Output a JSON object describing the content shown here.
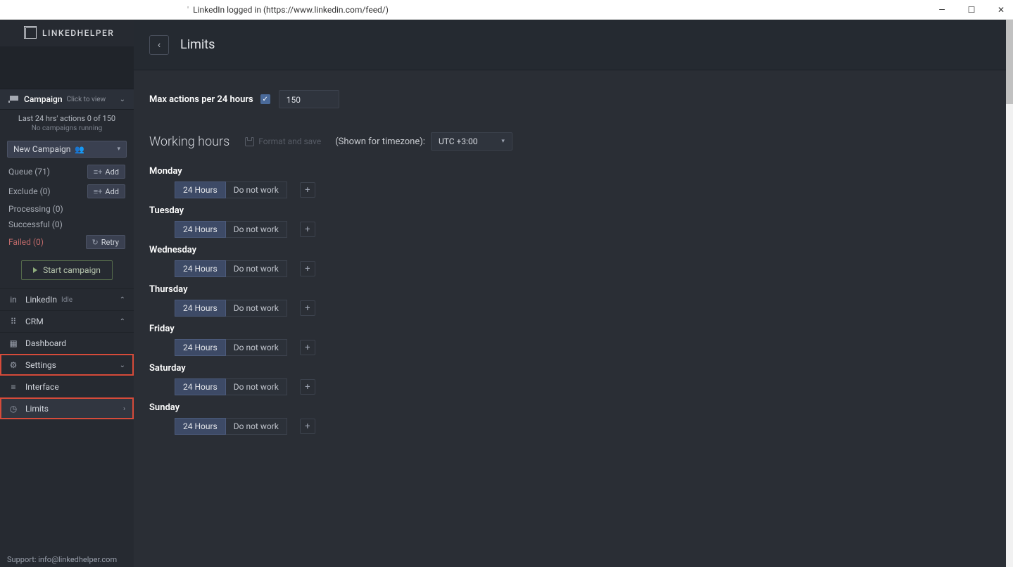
{
  "window": {
    "title": "LinkedIn logged in (https://www.linkedin.com/feed/)"
  },
  "brand": "LINKEDHELPER",
  "campaign_section": {
    "title": "Campaign",
    "hint": "Click to view",
    "status_line1": "Last 24 hrs' actions 0 of 150",
    "status_line2": "No campaigns running",
    "selector": "New Campaign",
    "rows": {
      "queue": "Queue (71)",
      "exclude": "Exclude (0)",
      "processing": "Processing (0)",
      "successful": "Successful (0)",
      "failed": "Failed (0)"
    },
    "add_label": "Add",
    "retry_label": "Retry",
    "start_label": "Start campaign"
  },
  "nav": {
    "linkedin": {
      "label": "LinkedIn",
      "badge": "Idle"
    },
    "crm": {
      "label": "CRM"
    },
    "dashboard": {
      "label": "Dashboard"
    },
    "settings": {
      "label": "Settings"
    },
    "interface": {
      "label": "Interface"
    },
    "limits": {
      "label": "Limits"
    }
  },
  "support": {
    "label": "Support:",
    "email": "info@linkedhelper.com"
  },
  "page": {
    "title": "Limits",
    "max_label": "Max actions per 24 hours",
    "max_value": "150",
    "working_hours": "Working hours",
    "format_save": "Format and save",
    "tz_label": "(Shown for timezone):",
    "tz_value": "UTC +3:00",
    "btn_24h": "24 Hours",
    "btn_dnw": "Do not work",
    "days": [
      "Monday",
      "Tuesday",
      "Wednesday",
      "Thursday",
      "Friday",
      "Saturday",
      "Sunday"
    ]
  }
}
